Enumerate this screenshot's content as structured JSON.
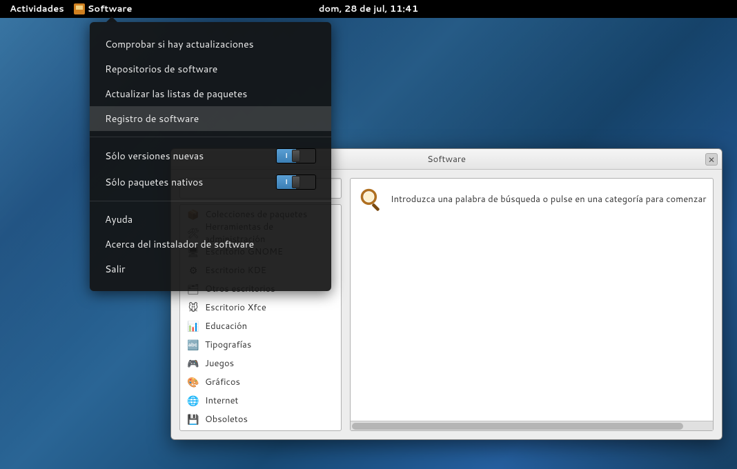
{
  "topbar": {
    "activities": "Actividades",
    "app_name": "Software",
    "clock": "dom, 28 de jul, 11:41"
  },
  "window": {
    "title": "Software",
    "hint": "Introduzca una palabra de búsqueda o pulse en una categoría para comenzar",
    "categories": [
      {
        "icon": "📦",
        "label": "Colecciones de paquetes"
      },
      {
        "icon": "🛠",
        "label": "Herramientas de administración"
      },
      {
        "icon": "🖥",
        "label": "Escritorio GNOME"
      },
      {
        "icon": "⚙",
        "label": "Escritorio KDE"
      },
      {
        "icon": "🗂",
        "label": "Otros escritorios"
      },
      {
        "icon": "🐭",
        "label": "Escritorio Xfce"
      },
      {
        "icon": "📊",
        "label": "Educación"
      },
      {
        "icon": "🔤",
        "label": "Tipografías"
      },
      {
        "icon": "🎮",
        "label": "Juegos"
      },
      {
        "icon": "🎨",
        "label": "Gráficos"
      },
      {
        "icon": "🌐",
        "label": "Internet"
      },
      {
        "icon": "💾",
        "label": "Obsoletos"
      }
    ]
  },
  "menu": {
    "items_top": [
      "Comprobar si hay actualizaciones",
      "Repositorios de software",
      "Actualizar las listas de paquetes",
      "Registro de software"
    ],
    "toggles": [
      {
        "label": "Sólo versiones nuevas",
        "on_glyph": "I",
        "state": true
      },
      {
        "label": "Sólo paquetes nativos",
        "on_glyph": "I",
        "state": true
      }
    ],
    "items_bottom": [
      "Ayuda",
      "Acerca del instalador de software",
      "Salir"
    ]
  }
}
